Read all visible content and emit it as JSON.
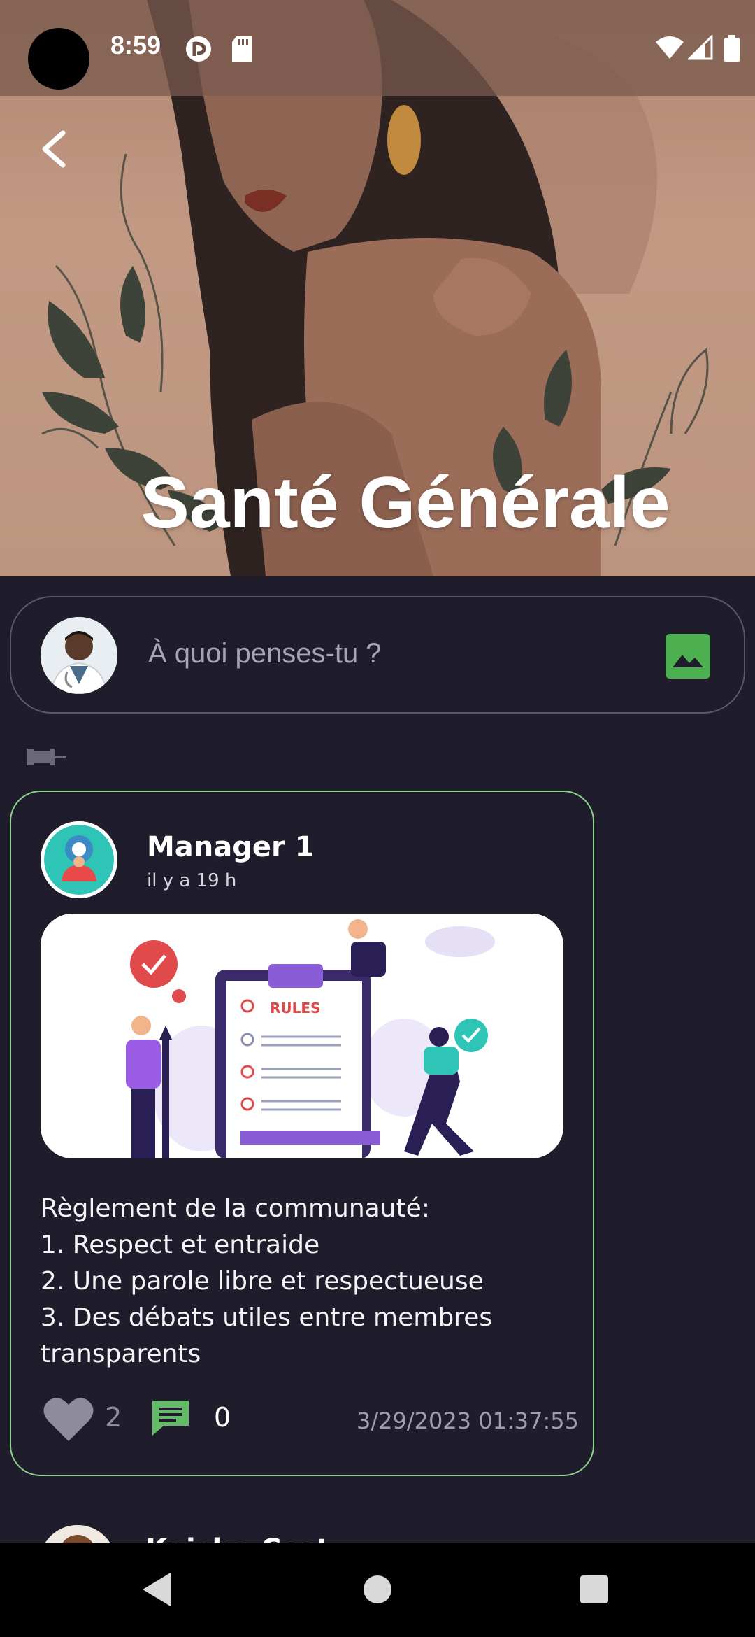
{
  "status_bar": {
    "time": "8:59"
  },
  "header": {
    "title": "Santé Générale"
  },
  "composer": {
    "placeholder": "À quoi penses-tu ?"
  },
  "post": {
    "author": "Manager 1",
    "time_ago": "il y a 19 h",
    "image_text": "RULES",
    "body_lines": [
      "Règlement de la communauté:",
      "1. Respect et entraide",
      "2. Une parole libre et respectueuse",
      "3. Des débats utiles entre membres",
      "transparents"
    ],
    "likes": "2",
    "comments": "0",
    "date": "3/29/2023 01:37:55"
  },
  "next_post": {
    "author_partial": "Kaisha Cast"
  },
  "colors": {
    "background": "#1f1d2b",
    "accent_green": "#4caf50",
    "card_border": "#8fd08f"
  }
}
